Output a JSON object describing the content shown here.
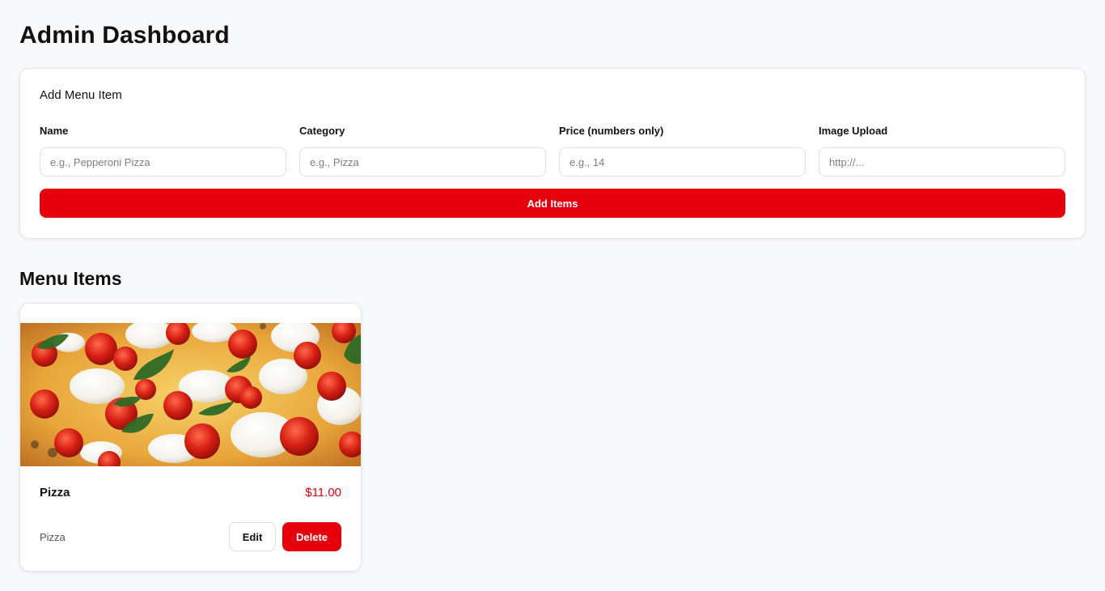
{
  "page": {
    "title": "Admin Dashboard"
  },
  "form": {
    "title": "Add Menu Item",
    "fields": [
      {
        "label": "Name",
        "placeholder": "e.g., Pepperoni Pizza",
        "value": ""
      },
      {
        "label": "Category",
        "placeholder": "e.g., Pizza",
        "value": ""
      },
      {
        "label": "Price (numbers only)",
        "placeholder": "e.g., 14",
        "value": ""
      },
      {
        "label": "Image Upload",
        "placeholder": "http://...",
        "value": ""
      }
    ],
    "submit_label": "Add Items"
  },
  "menu": {
    "title": "Menu Items",
    "items": [
      {
        "name": "Pizza",
        "price": "$11.00",
        "category": "Pizza",
        "image_icon": "pizza-photo",
        "edit_label": "Edit",
        "delete_label": "Delete"
      }
    ]
  },
  "colors": {
    "accent": "#e5000b",
    "background": "#f8f9fb",
    "card": "#ffffff",
    "border": "#e4e6ea"
  }
}
